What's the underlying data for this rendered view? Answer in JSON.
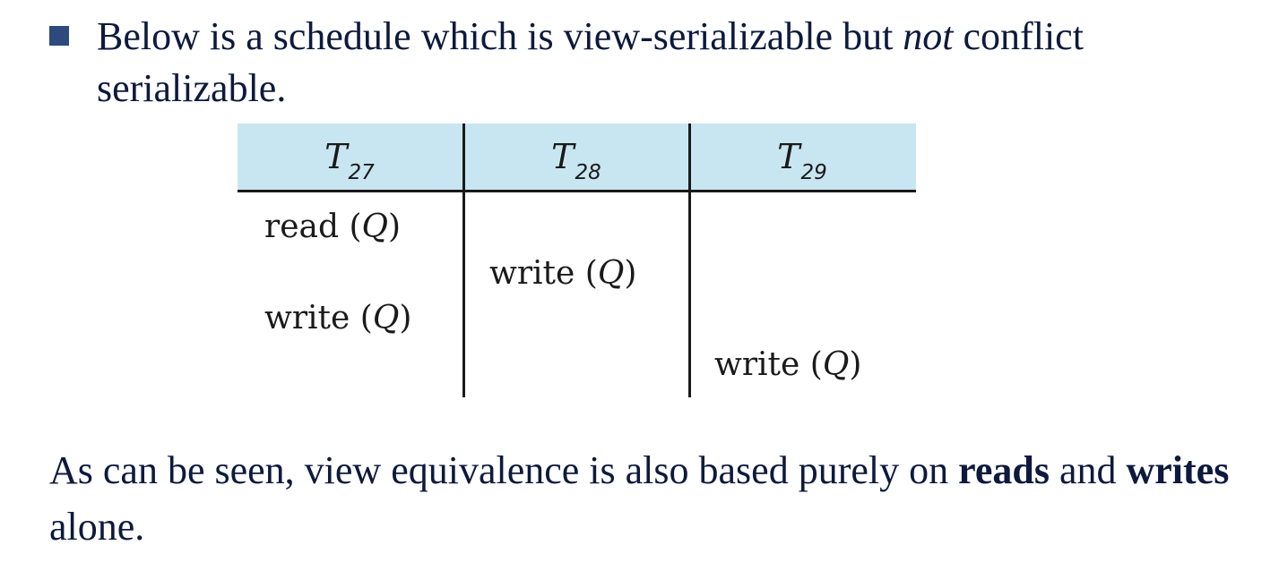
{
  "bullet": {
    "text_part1": "Below is a schedule which is view-serializable but ",
    "text_emphasis": "not",
    "text_part2": " conflict serializable."
  },
  "schedule": {
    "headers": [
      {
        "name": "T",
        "sub": "27"
      },
      {
        "name": "T",
        "sub": "28"
      },
      {
        "name": "T",
        "sub": "29"
      }
    ],
    "operations": [
      {
        "op": "read",
        "item": "Q"
      },
      {
        "op": "write",
        "item": "Q"
      },
      {
        "op": "write",
        "item": "Q"
      },
      {
        "op": "write",
        "item": "Q"
      }
    ]
  },
  "conclusion": {
    "part1": "As can be seen, view equivalence is also based purely on ",
    "bold1": "reads",
    "part2": " and ",
    "bold2": "writes",
    "part3": " alone."
  }
}
